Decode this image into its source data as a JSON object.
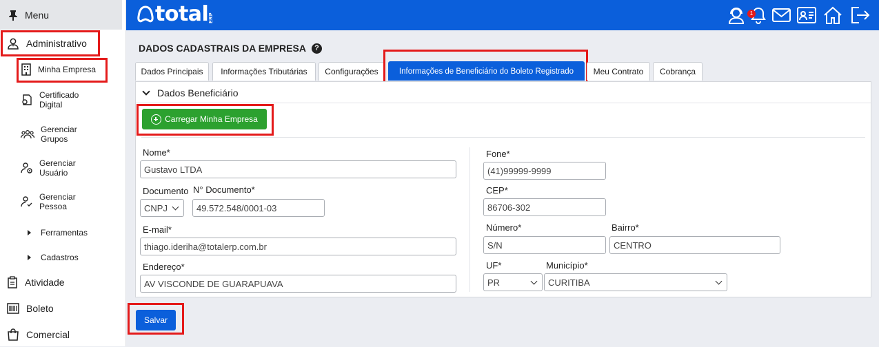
{
  "sidebar": {
    "menu_label": "Menu",
    "items": [
      {
        "label": "Administrativo",
        "icon": "admin-user-icon"
      },
      {
        "label": "Atividade",
        "icon": "clipboard-icon"
      },
      {
        "label": "Boleto",
        "icon": "barcode-icon"
      },
      {
        "label": "Comercial",
        "icon": "shopping-bag-icon"
      }
    ],
    "sub_items": [
      {
        "label_line1": "Minha Empresa",
        "label_line2": "",
        "icon": "building-icon"
      },
      {
        "label_line1": "Certificado",
        "label_line2": "Digital",
        "icon": "certificate-icon"
      },
      {
        "label_line1": "Gerenciar",
        "label_line2": "Grupos",
        "icon": "group-icon"
      },
      {
        "label_line1": "Gerenciar",
        "label_line2": "Usuário",
        "icon": "user-gear-icon"
      },
      {
        "label_line1": "Gerenciar",
        "label_line2": "Pessoa",
        "icon": "person-check-icon"
      }
    ],
    "expanders": [
      {
        "label": "Ferramentas"
      },
      {
        "label": "Cadastros"
      }
    ]
  },
  "header": {
    "logo_text": "total",
    "logo_sub": "ERP",
    "notification_count": "1",
    "icons": [
      "support-agent-icon",
      "bell-icon",
      "mail-icon",
      "id-card-icon",
      "home-icon",
      "logout-icon"
    ]
  },
  "page": {
    "title": "DADOS CADASTRAIS DA EMPRESA",
    "help": "?"
  },
  "tabs": [
    {
      "label": "Dados Principais"
    },
    {
      "label": "Informações Tributárias"
    },
    {
      "label": "Configurações"
    },
    {
      "label": "Informações de Beneficiário do Boleto Registrado"
    },
    {
      "label": "Meu Contrato"
    },
    {
      "label": "Cobrança"
    }
  ],
  "section": {
    "title": "Dados Beneficiário",
    "load_button": "Carregar Minha Empresa"
  },
  "form": {
    "nome_label": "Nome*",
    "nome_value": "Gustavo LTDA",
    "documento_label": "Documento",
    "documento_value": "CNPJ",
    "ndoc_label": "N° Documento*",
    "ndoc_value": "49.572.548/0001-03",
    "email_label": "E-mail*",
    "email_value": "thiago.ideriha@totalerp.com.br",
    "endereco_label": "Endereço*",
    "endereco_value": "AV VISCONDE DE GUARAPUAVA",
    "fone_label": "Fone*",
    "fone_value": "(41)99999-9999",
    "cep_label": "CEP*",
    "cep_value": "86706-302",
    "numero_label": "Número*",
    "numero_value": "S/N",
    "bairro_label": "Bairro*",
    "bairro_value": "CENTRO",
    "uf_label": "UF*",
    "uf_value": "PR",
    "municipio_label": "Município*",
    "municipio_value": "CURITIBA"
  },
  "save_button": "Salvar",
  "colors": {
    "brand_blue": "#0b5fdb",
    "green": "#2ca12f",
    "highlight_red": "#e41a1a"
  }
}
